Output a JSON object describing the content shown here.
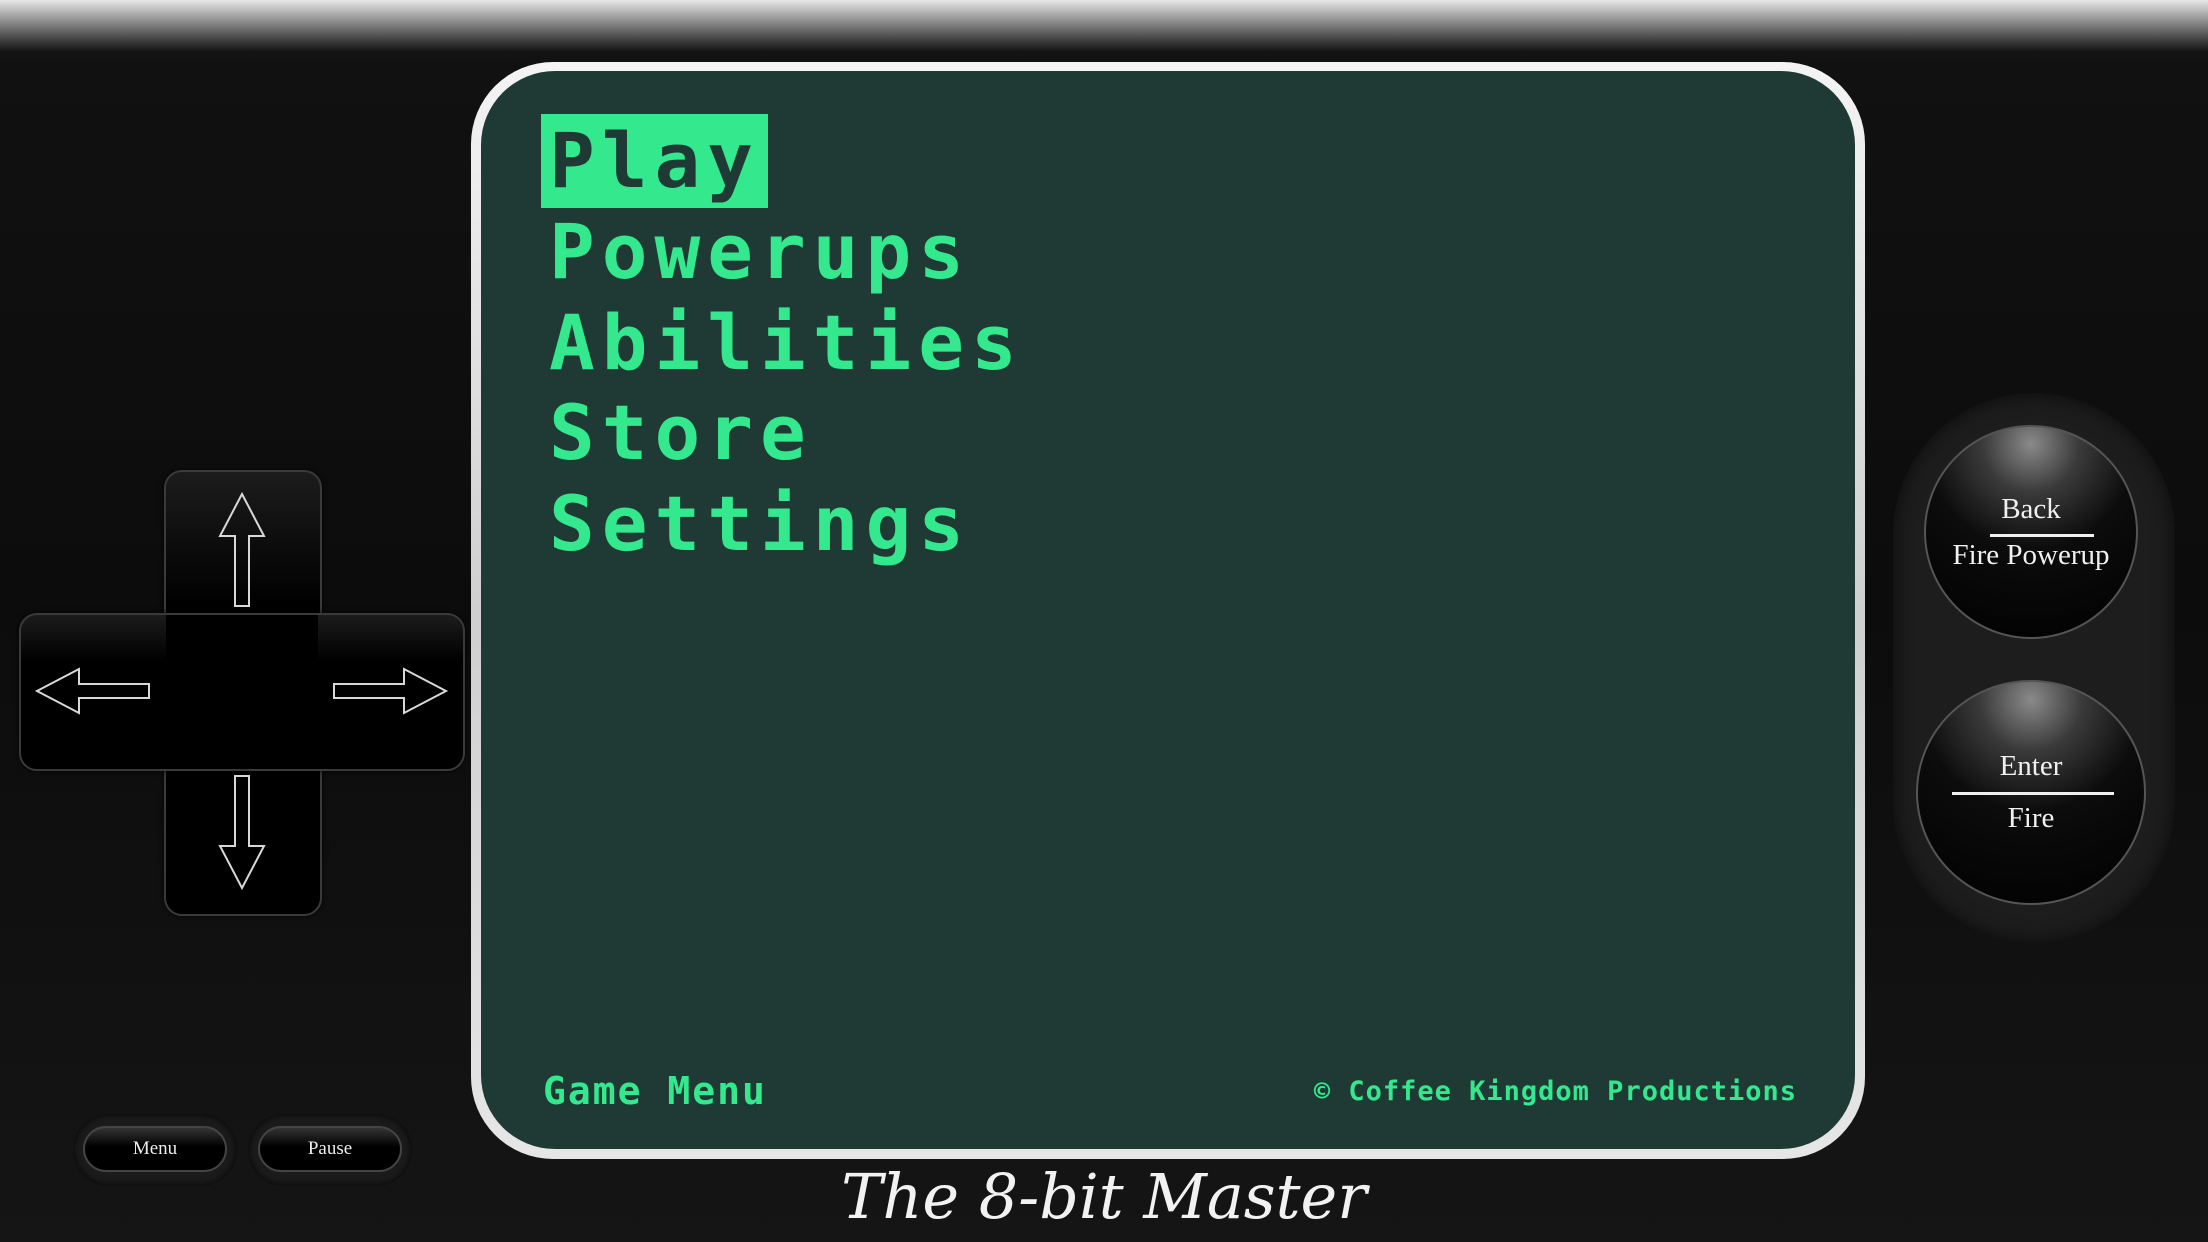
{
  "screen": {
    "menu_items": [
      "Play",
      "Powerups",
      "Abilities",
      "Store",
      "Settings"
    ],
    "selected_index": 0,
    "footer_left": "Game Menu",
    "footer_right": "© Coffee Kingdom Productions"
  },
  "controls": {
    "menu_button": "Menu",
    "pause_button": "Pause",
    "back_button": {
      "top_label": "Back",
      "bottom_label": "Fire Powerup"
    },
    "enter_button": {
      "top_label": "Enter",
      "bottom_label": "Fire"
    },
    "dpad_icons": [
      "arrow-up-icon",
      "arrow-down-icon",
      "arrow-left-icon",
      "arrow-right-icon"
    ]
  },
  "footer": {
    "title": "The 8-bit Master"
  },
  "colors": {
    "screen_bg": "#1f3a35",
    "screen_text": "#34e88e"
  }
}
